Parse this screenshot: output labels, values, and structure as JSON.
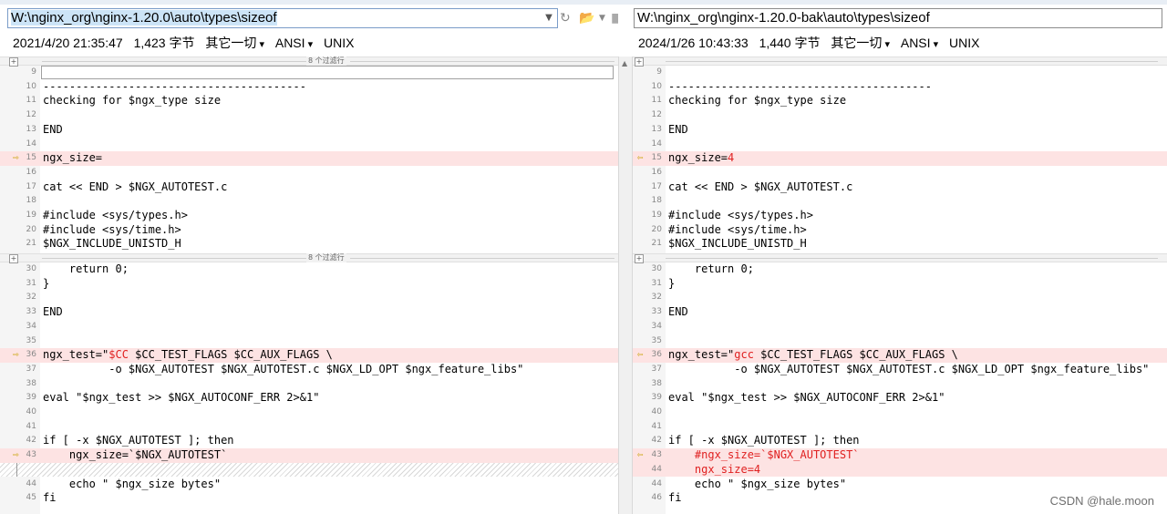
{
  "left": {
    "path": "W:\\nginx_org\\nginx-1.20.0\\auto\\types\\sizeof",
    "date": "2021/4/20 21:35:47",
    "size": "1,423 字节",
    "type": "其它一切",
    "encoding": "ANSI",
    "eol": "UNIX"
  },
  "right": {
    "path": "W:\\nginx_org\\nginx-1.20.0-bak\\auto\\types\\sizeof",
    "date": "2024/1/26 10:43:33",
    "size": "1,440 字节",
    "type": "其它一切",
    "encoding": "ANSI",
    "eol": "UNIX"
  },
  "filter_label": "8 个过滤行",
  "plus_sign": "+",
  "marker_glyph": "⇨",
  "marker_glyph_right": "⇦",
  "watermark": "CSDN @hale.moon",
  "colors": {
    "diff_bg": "#fde3e3",
    "diff_text": "#e02020",
    "selection": "#cce4f7"
  },
  "left_rows": [
    {
      "n": "9",
      "t": ""
    },
    {
      "n": "10",
      "t": "----------------------------------------"
    },
    {
      "n": "11",
      "t": "checking for $ngx_type size"
    },
    {
      "n": "12",
      "t": ""
    },
    {
      "n": "13",
      "t": "END"
    },
    {
      "n": "14",
      "t": ""
    },
    {
      "n": "15",
      "t": "ngx_size=",
      "diff": true,
      "mark": true
    },
    {
      "n": "16",
      "t": ""
    },
    {
      "n": "17",
      "t": "cat << END > $NGX_AUTOTEST.c"
    },
    {
      "n": "18",
      "t": ""
    },
    {
      "n": "19",
      "t": "#include <sys/types.h>"
    },
    {
      "n": "20",
      "t": "#include <sys/time.h>"
    },
    {
      "n": "21",
      "t": "$NGX_INCLUDE_UNISTD_H"
    },
    {
      "n": "30",
      "t": "    return 0;"
    },
    {
      "n": "31",
      "t": "}"
    },
    {
      "n": "32",
      "t": ""
    },
    {
      "n": "33",
      "t": "END"
    },
    {
      "n": "34",
      "t": ""
    },
    {
      "n": "35",
      "t": ""
    },
    {
      "n": "36",
      "t": "ngx_test=\"",
      "red": "$CC",
      "rest": " $CC_TEST_FLAGS $CC_AUX_FLAGS \\",
      "diff": true,
      "mark": true
    },
    {
      "n": "37",
      "t": "          -o $NGX_AUTOTEST $NGX_AUTOTEST.c $NGX_LD_OPT $ngx_feature_libs\""
    },
    {
      "n": "38",
      "t": ""
    },
    {
      "n": "39",
      "t": "eval \"$ngx_test >> $NGX_AUTOCONF_ERR 2>&1\""
    },
    {
      "n": "40",
      "t": ""
    },
    {
      "n": "41",
      "t": ""
    },
    {
      "n": "42",
      "t": "if [ -x $NGX_AUTOTEST ]; then"
    },
    {
      "n": "43",
      "t": "    ngx_size=`$NGX_AUTOTEST`",
      "diff": true,
      "mark": true
    },
    {
      "n": "",
      "t": "",
      "hatch": true
    },
    {
      "n": "44",
      "t": "    echo \" $ngx_size bytes\""
    },
    {
      "n": "45",
      "t": "fi"
    }
  ],
  "right_rows": [
    {
      "n": "9",
      "t": ""
    },
    {
      "n": "10",
      "t": "----------------------------------------"
    },
    {
      "n": "11",
      "t": "checking for $ngx_type size"
    },
    {
      "n": "12",
      "t": ""
    },
    {
      "n": "13",
      "t": "END"
    },
    {
      "n": "14",
      "t": ""
    },
    {
      "n": "15",
      "t": "ngx_size=",
      "red": "4",
      "rest": "",
      "diff": true,
      "mark": true
    },
    {
      "n": "16",
      "t": ""
    },
    {
      "n": "17",
      "t": "cat << END > $NGX_AUTOTEST.c"
    },
    {
      "n": "18",
      "t": ""
    },
    {
      "n": "19",
      "t": "#include <sys/types.h>"
    },
    {
      "n": "20",
      "t": "#include <sys/time.h>"
    },
    {
      "n": "21",
      "t": "$NGX_INCLUDE_UNISTD_H"
    },
    {
      "n": "30",
      "t": "    return 0;"
    },
    {
      "n": "31",
      "t": "}"
    },
    {
      "n": "32",
      "t": ""
    },
    {
      "n": "33",
      "t": "END"
    },
    {
      "n": "34",
      "t": ""
    },
    {
      "n": "35",
      "t": ""
    },
    {
      "n": "36",
      "t": "ngx_test=\"",
      "red": "gcc",
      "rest": " $CC_TEST_FLAGS $CC_AUX_FLAGS \\",
      "diff": true,
      "mark": true
    },
    {
      "n": "37",
      "t": "          -o $NGX_AUTOTEST $NGX_AUTOTEST.c $NGX_LD_OPT $ngx_feature_libs\""
    },
    {
      "n": "38",
      "t": ""
    },
    {
      "n": "39",
      "t": "eval \"$ngx_test >> $NGX_AUTOCONF_ERR 2>&1\""
    },
    {
      "n": "40",
      "t": ""
    },
    {
      "n": "41",
      "t": ""
    },
    {
      "n": "42",
      "t": "if [ -x $NGX_AUTOTEST ]; then"
    },
    {
      "n": "43",
      "t": "    ",
      "red": "#ngx_size=`$NGX_AUTOTEST`",
      "rest": "",
      "diff": true,
      "mark": true
    },
    {
      "n": "44",
      "t": "    ",
      "red": "ngx_size=4",
      "rest": "",
      "diff": true
    },
    {
      "n": "44",
      "t": "    echo \" $ngx_size bytes\""
    },
    {
      "n": "46",
      "t": "fi"
    }
  ]
}
